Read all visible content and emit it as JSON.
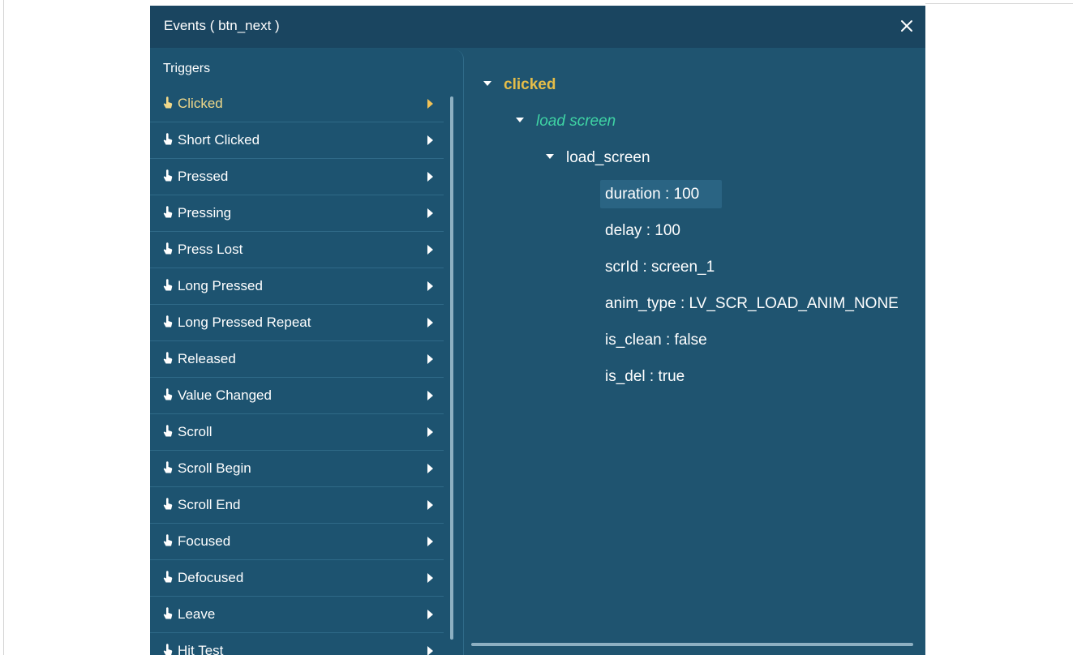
{
  "dialog": {
    "title": "Events ( btn_next )",
    "close_icon": "close-icon"
  },
  "triggers": {
    "header": "Triggers",
    "active_color": "#f1d98a",
    "items": [
      {
        "label": "Clicked"
      },
      {
        "label": "Short Clicked"
      },
      {
        "label": "Pressed"
      },
      {
        "label": "Pressing"
      },
      {
        "label": "Press Lost"
      },
      {
        "label": "Long Pressed"
      },
      {
        "label": "Long Pressed Repeat"
      },
      {
        "label": "Released"
      },
      {
        "label": "Value Changed"
      },
      {
        "label": "Scroll"
      },
      {
        "label": "Scroll Begin"
      },
      {
        "label": "Scroll End"
      },
      {
        "label": "Focused"
      },
      {
        "label": "Defocused"
      },
      {
        "label": "Leave"
      },
      {
        "label": "Hit Test"
      }
    ]
  },
  "tree": {
    "event": "clicked",
    "action": "load screen",
    "function": "load_screen",
    "props": [
      "duration : 100",
      "delay : 100",
      "scrId : screen_1",
      "anim_type : LV_SCR_LOAD_ANIM_NONE",
      "is_clean : false",
      "is_del : true"
    ]
  }
}
